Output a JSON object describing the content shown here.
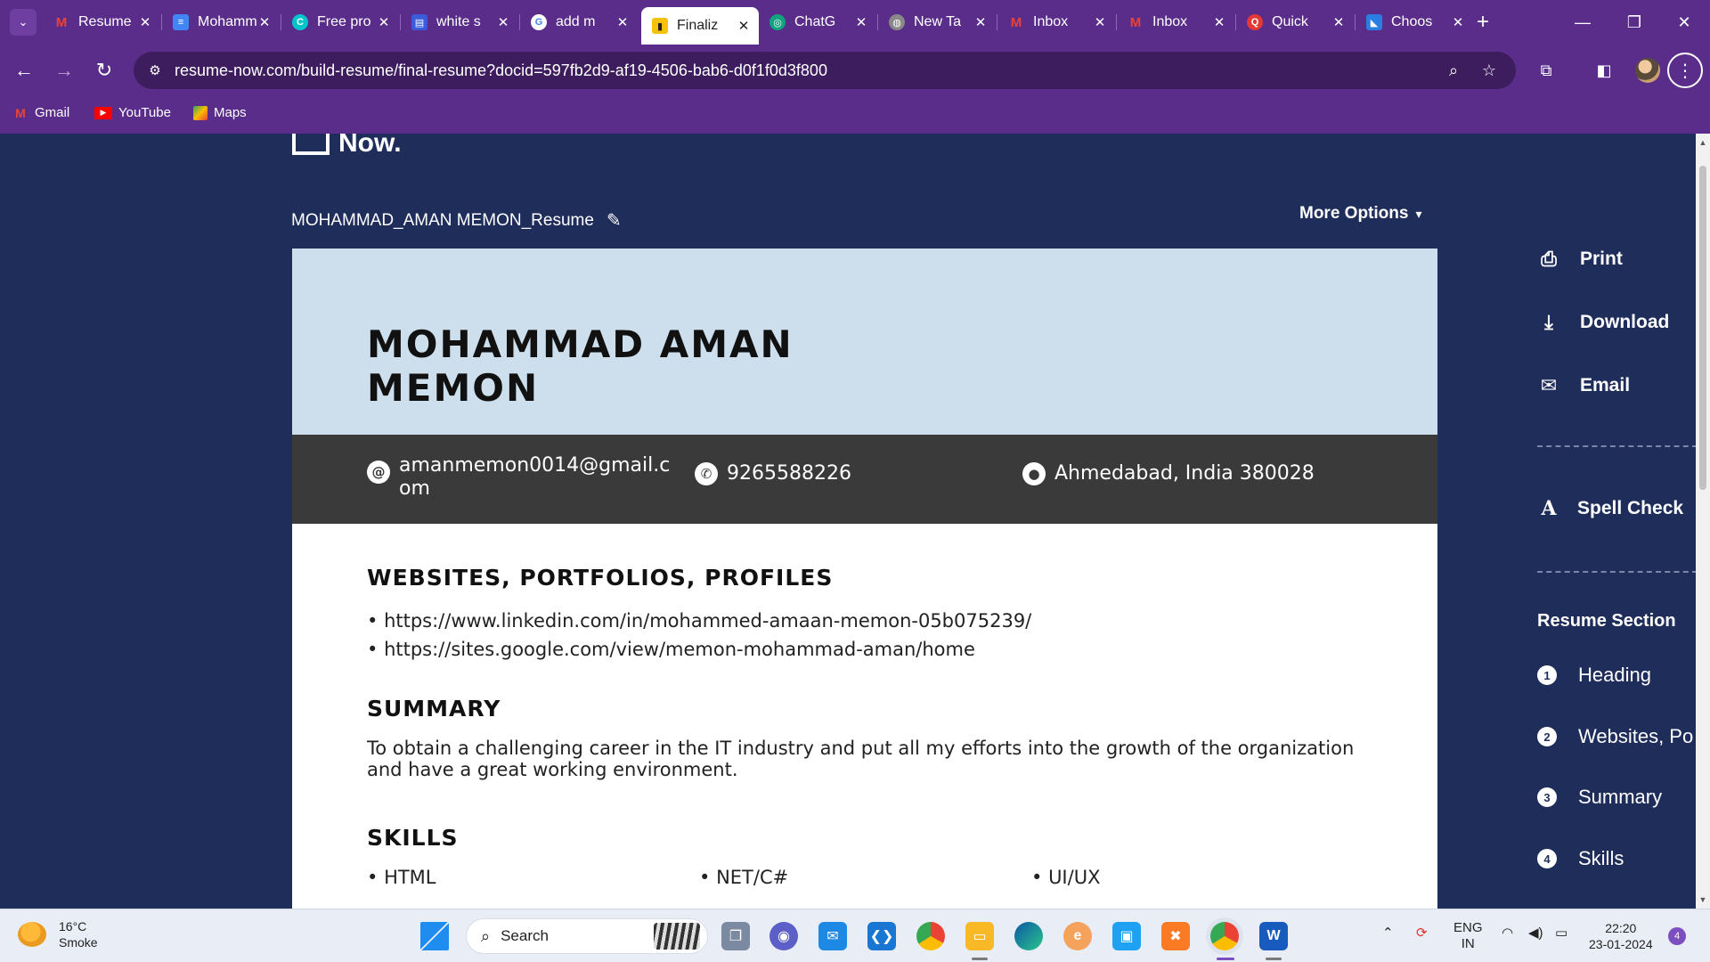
{
  "browser": {
    "tabs": [
      {
        "title": "Resume",
        "favicon": "gmail-icon",
        "color": "#ea4335",
        "glyph": "M"
      },
      {
        "title": "Mohammad",
        "favicon": "docs-icon",
        "color": "#4285f4",
        "glyph": "≡"
      },
      {
        "title": "Free pro",
        "favicon": "canva-icon",
        "color": "#00c4cc",
        "glyph": "C"
      },
      {
        "title": "white s",
        "favicon": "doc-icon",
        "color": "#3b5bdb",
        "glyph": "▤"
      },
      {
        "title": "add m",
        "favicon": "google-icon",
        "color": "#4285f4",
        "glyph": "G"
      },
      {
        "title": "Finaliz",
        "favicon": "resume-now-icon",
        "color": "#f4c20d",
        "glyph": "▮",
        "active": true
      },
      {
        "title": "ChatG",
        "favicon": "chatgpt-icon",
        "color": "#10a37f",
        "glyph": "◎"
      },
      {
        "title": "New Ta",
        "favicon": "globe-icon",
        "color": "#888888",
        "glyph": "◍"
      },
      {
        "title": "Inbox",
        "favicon": "gmail-icon",
        "color": "#ea4335",
        "glyph": "M"
      },
      {
        "title": "Inbox",
        "favicon": "gmail-icon",
        "color": "#ea4335",
        "glyph": "M"
      },
      {
        "title": "Quick",
        "favicon": "quickheal-icon",
        "color": "#e53935",
        "glyph": "Q"
      },
      {
        "title": "Choos",
        "favicon": "edge-icon",
        "color": "#2a7de1",
        "glyph": "◣"
      }
    ],
    "url": "resume-now.com/build-resume/final-resume?docid=597fb2d9-af19-4506-bab6-d0f1f0d3f800",
    "bookmarks": [
      {
        "label": "Gmail",
        "icon": "gmail-icon",
        "color": "#ea4335"
      },
      {
        "label": "YouTube",
        "icon": "youtube-icon",
        "color": "#ff0000"
      },
      {
        "label": "Maps",
        "icon": "maps-icon",
        "color": "#34a853"
      }
    ]
  },
  "page": {
    "logo_text": "Now.",
    "document_name": "MOHAMMAD_AMAN MEMON_Resume",
    "more_options_label": "More Options"
  },
  "resume": {
    "name_line1": "MOHAMMAD AMAN",
    "name_line2": "MEMON",
    "email_line1": "amanmemon0014@gmail.c",
    "email_line2": "om",
    "phone": "9265588226",
    "location": "Ahmedabad, India 380028",
    "websites_title": "WEBSITES, PORTFOLIOS, PROFILES",
    "websites": [
      "https://www.linkedin.com/in/mohammed-amaan-memon-05b075239/",
      "https://sites.google.com/view/memon-mohammad-aman/home"
    ],
    "summary_title": "SUMMARY",
    "summary_text": "To obtain a challenging career in the IT industry and put all my efforts into the growth of the organization and have a great working environment.",
    "skills_title": "SKILLS",
    "skills": [
      "HTML",
      "NET/C#",
      "UI/UX"
    ]
  },
  "sidebar": {
    "actions": [
      {
        "label": "Print",
        "icon": "printer-icon"
      },
      {
        "label": "Download",
        "icon": "download-icon"
      },
      {
        "label": "Email",
        "icon": "envelope-icon"
      }
    ],
    "spell_check_label": "Spell Check",
    "sections_heading": "Resume Section",
    "sections": [
      {
        "num": "1",
        "label": "Heading"
      },
      {
        "num": "2",
        "label": "Websites, Po"
      },
      {
        "num": "3",
        "label": "Summary"
      },
      {
        "num": "4",
        "label": "Skills"
      }
    ]
  },
  "taskbar": {
    "temperature": "16°C",
    "weather": "Smoke",
    "search_placeholder": "Search",
    "language_line1": "ENG",
    "language_line2": "IN",
    "time": "22:20",
    "date": "23-01-2024",
    "notification_count": "4"
  },
  "colors": {
    "browser_frame": "#5a2d8a",
    "page_background": "#1f2d5b",
    "resume_header": "#cddfed",
    "resume_contact_bar": "#3a3a3a"
  }
}
